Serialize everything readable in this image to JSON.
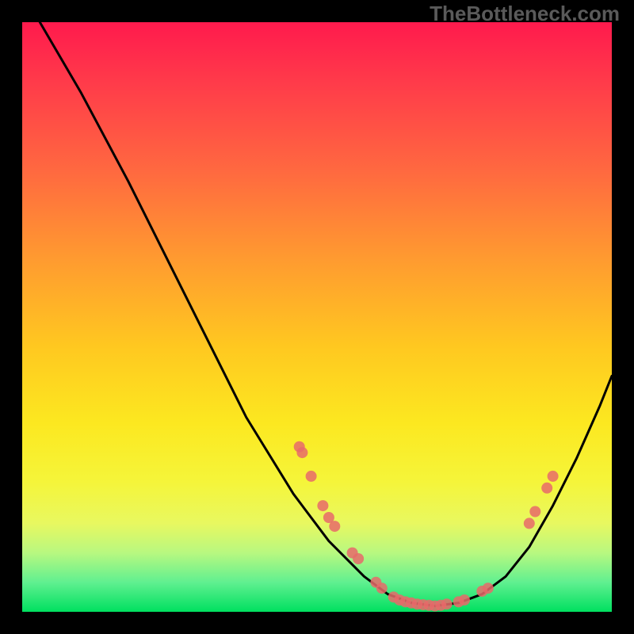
{
  "watermark": "TheBottleneck.com",
  "chart_data": {
    "type": "line",
    "title": "",
    "xlabel": "",
    "ylabel": "",
    "xlim": [
      0,
      100
    ],
    "ylim": [
      0,
      100
    ],
    "curve": [
      {
        "x": 3,
        "y": 100
      },
      {
        "x": 10,
        "y": 88
      },
      {
        "x": 18,
        "y": 73
      },
      {
        "x": 28,
        "y": 53
      },
      {
        "x": 38,
        "y": 33
      },
      {
        "x": 46,
        "y": 20
      },
      {
        "x": 52,
        "y": 12
      },
      {
        "x": 58,
        "y": 6
      },
      {
        "x": 62,
        "y": 3
      },
      {
        "x": 66,
        "y": 1.5
      },
      {
        "x": 70,
        "y": 1
      },
      {
        "x": 74,
        "y": 1.5
      },
      {
        "x": 78,
        "y": 3
      },
      {
        "x": 82,
        "y": 6
      },
      {
        "x": 86,
        "y": 11
      },
      {
        "x": 90,
        "y": 18
      },
      {
        "x": 94,
        "y": 26
      },
      {
        "x": 98,
        "y": 35
      },
      {
        "x": 100,
        "y": 40
      }
    ],
    "scatter_points": [
      {
        "x": 47,
        "y": 28
      },
      {
        "x": 47.5,
        "y": 27
      },
      {
        "x": 49,
        "y": 23
      },
      {
        "x": 51,
        "y": 18
      },
      {
        "x": 52,
        "y": 16
      },
      {
        "x": 53,
        "y": 14.5
      },
      {
        "x": 56,
        "y": 10
      },
      {
        "x": 57,
        "y": 9
      },
      {
        "x": 60,
        "y": 5
      },
      {
        "x": 61,
        "y": 4
      },
      {
        "x": 63,
        "y": 2.5
      },
      {
        "x": 64,
        "y": 2
      },
      {
        "x": 65,
        "y": 1.7
      },
      {
        "x": 66,
        "y": 1.5
      },
      {
        "x": 67,
        "y": 1.3
      },
      {
        "x": 68,
        "y": 1.2
      },
      {
        "x": 69,
        "y": 1.1
      },
      {
        "x": 70,
        "y": 1
      },
      {
        "x": 71,
        "y": 1.1
      },
      {
        "x": 72,
        "y": 1.3
      },
      {
        "x": 74,
        "y": 1.7
      },
      {
        "x": 75,
        "y": 2
      },
      {
        "x": 78,
        "y": 3.5
      },
      {
        "x": 79,
        "y": 4
      },
      {
        "x": 86,
        "y": 15
      },
      {
        "x": 87,
        "y": 17
      },
      {
        "x": 89,
        "y": 21
      },
      {
        "x": 90,
        "y": 23
      }
    ],
    "gradient_stops": [
      {
        "pos": 0,
        "color": "#ff1a4d"
      },
      {
        "pos": 50,
        "color": "#ffc820"
      },
      {
        "pos": 100,
        "color": "#00e060"
      }
    ]
  }
}
